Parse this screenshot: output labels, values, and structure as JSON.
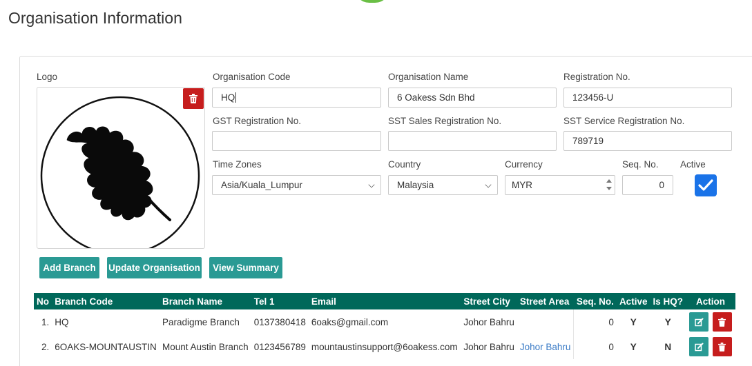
{
  "page": {
    "title": "Organisation Information"
  },
  "form": {
    "logo_label": "Logo",
    "org_code": {
      "label": "Organisation Code",
      "value": "HQ"
    },
    "org_name": {
      "label": "Organisation Name",
      "value": "6 Oakess Sdn Bhd"
    },
    "reg_no": {
      "label": "Registration No.",
      "value": "123456-U"
    },
    "gst_reg": {
      "label": "GST Registration No.",
      "value": ""
    },
    "sst_sales": {
      "label": "SST Sales Registration No.",
      "value": ""
    },
    "sst_service": {
      "label": "SST Service Registration No.",
      "value": "789719"
    },
    "timezone": {
      "label": "Time Zones",
      "value": "Asia/Kuala_Lumpur"
    },
    "country": {
      "label": "Country",
      "value": "Malaysia"
    },
    "currency": {
      "label": "Currency",
      "value": "MYR"
    },
    "seq_no": {
      "label": "Seq. No.",
      "value": "0"
    },
    "active": {
      "label": "Active",
      "checked": true
    }
  },
  "buttons": {
    "add_branch": "Add Branch",
    "update_org": "Update Organisation",
    "view_summary": "View Summary"
  },
  "table": {
    "headers": [
      "No",
      "Branch Code",
      "Branch Name",
      "Tel 1",
      "Email",
      "Street City",
      "Street Area",
      "Seq. No.",
      "Active",
      "Is HQ?",
      "Action"
    ],
    "rows": [
      {
        "no": "1.",
        "code": "HQ",
        "name": "Paradigme Branch",
        "tel": "0137380418",
        "email": "6oaks@gmail.com",
        "city": "Johor Bahru",
        "area": "",
        "seq": "0",
        "active": "Y",
        "hq": "Y"
      },
      {
        "no": "2.",
        "code": "6OAKS-MOUNTAUSTIN",
        "name": "Mount Austin Branch",
        "tel": "0123456789",
        "email": "mountaustinsupport@6oakess.com",
        "city": "Johor Bahru",
        "area": "Johor Bahru",
        "seq": "0",
        "active": "Y",
        "hq": "N"
      }
    ]
  },
  "colors": {
    "teal": "#2a9a94",
    "header_green": "#00685a",
    "danger": "#c61d1d",
    "checkbox_blue": "#1a73e8"
  }
}
